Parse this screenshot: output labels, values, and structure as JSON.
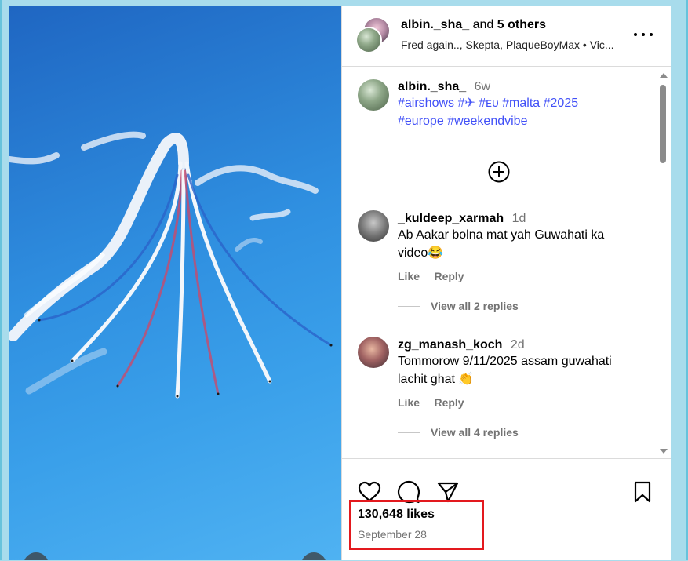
{
  "header": {
    "username": "albin._sha_",
    "joiner": "and",
    "others": "5 others",
    "audio": "Fred again.., Skepta, PlaqueBoyMax • Vic..."
  },
  "caption": {
    "username": "albin._sha_",
    "ago": "6w",
    "hashtags_line1": "#airshows #✈ #ᴇᴜ #malta #2025",
    "hashtags_line2": "#europe #weekendvibe"
  },
  "comments": [
    {
      "username": "_kuldeep_xarmah",
      "ago": "1d",
      "text_line1": "Ab Aakar bolna mat yah Guwahati ka",
      "text_line2": "video😂",
      "like": "Like",
      "reply": "Reply",
      "view_replies": "View all 2 replies"
    },
    {
      "username": "zg_manash_koch",
      "ago": "2d",
      "text_line1": "Tommorow 9/11/2025 assam guwahati",
      "text_line2": "lachit ghat 👏",
      "like": "Like",
      "reply": "Reply",
      "view_replies": "View all 4 replies"
    }
  ],
  "footer": {
    "likes": "130,648 likes",
    "date": "September 28"
  },
  "icons": {
    "like": "heart-icon",
    "comment": "comment-icon",
    "share": "share-icon",
    "save": "bookmark-icon",
    "add": "plus-circle-icon",
    "more": "more-icon"
  },
  "colors": {
    "hashtag": "#4150f7",
    "highlight": "#e3191e"
  }
}
